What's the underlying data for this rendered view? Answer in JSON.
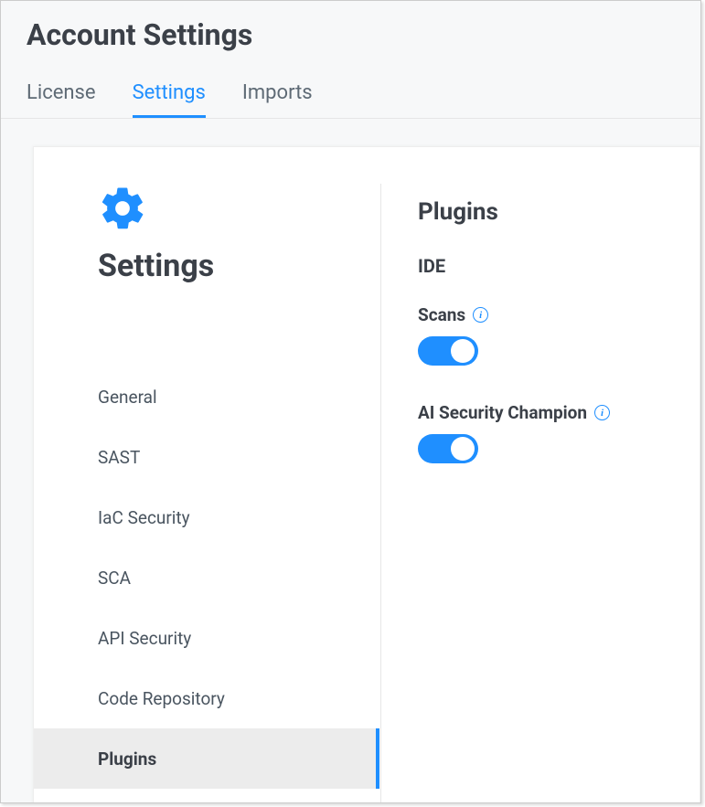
{
  "page": {
    "title": "Account Settings"
  },
  "topTabs": {
    "license": "License",
    "settings": "Settings",
    "imports": "Imports"
  },
  "leftPanel": {
    "title": "Settings"
  },
  "nav": {
    "general": "General",
    "sast": "SAST",
    "iac": "IaC Security",
    "sca": "SCA",
    "api": "API Security",
    "coderepo": "Code Repository",
    "plugins": "Plugins"
  },
  "rightPanel": {
    "title": "Plugins",
    "groupIDE": "IDE",
    "scans": {
      "label": "Scans",
      "enabled": true
    },
    "aiChampion": {
      "label": "AI Security Champion",
      "enabled": true
    }
  }
}
